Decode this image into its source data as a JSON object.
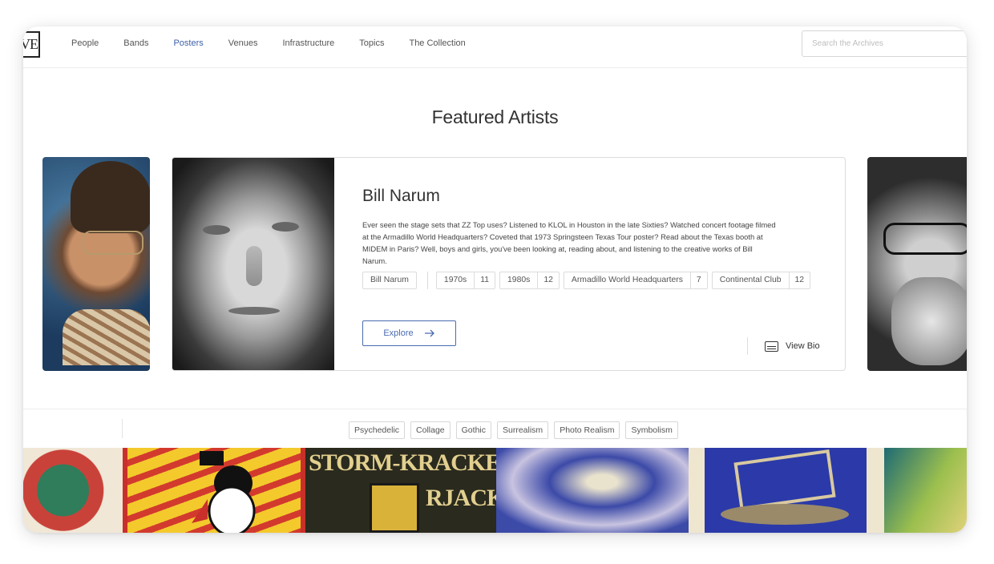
{
  "nav": {
    "logo_text": "VES",
    "items": [
      {
        "label": "People",
        "active": false
      },
      {
        "label": "Bands",
        "active": false
      },
      {
        "label": "Posters",
        "active": true
      },
      {
        "label": "Venues",
        "active": false
      },
      {
        "label": "Infrastructure",
        "active": false
      },
      {
        "label": "Topics",
        "active": false
      },
      {
        "label": "The Collection",
        "active": false
      }
    ],
    "search_placeholder": "Search the Archives",
    "accent_color": "#3d5fa6"
  },
  "featured": {
    "title": "Featured Artists",
    "artist": {
      "name": "Bill Narum",
      "description": "Ever seen the stage sets that ZZ Top uses? Listened to KLOL in Houston in the late Sixties? Watched concert footage filmed at the Armadillo World Headquarters? Coveted that 1973 Springsteen Texas Tour poster? Read about the Texas booth at MIDEM in Paris? Well, boys and girls, you've been looking at, reading about, and listening to the creative works of Bill Narum.",
      "name_tag": "Bill Narum",
      "tags": [
        {
          "label": "1970s",
          "count": "11"
        },
        {
          "label": "1980s",
          "count": "12"
        },
        {
          "label": "Armadillo World Headquarters",
          "count": "7"
        },
        {
          "label": "Continental Club",
          "count": "12"
        }
      ],
      "explore_label": "Explore",
      "bio_label": "View Bio"
    }
  },
  "styles": [
    "Psychedelic",
    "Collage",
    "Gothic",
    "Surrealism",
    "Photo Realism",
    "Symbolism"
  ],
  "posters": [
    {
      "name": "poster-psychedelic-green",
      "text": "",
      "colors": [
        "#2f7d5a",
        "#c9423a"
      ]
    },
    {
      "name": "poster-penguin",
      "text": "",
      "colors": [
        "#f3c92c",
        "#d33a2e"
      ]
    },
    {
      "name": "poster-storm-kracker",
      "text": "STORM-KRACKE- RJACK",
      "colors": [
        "#2a2a1e",
        "#e2cf8f"
      ]
    },
    {
      "name": "poster-blue-face",
      "text": "",
      "colors": [
        "#3c4aa8",
        "#e9e2cd"
      ]
    },
    {
      "name": "poster-starry",
      "text": "",
      "colors": [
        "#2b3aa8",
        "#c8b98d"
      ]
    },
    {
      "name": "poster-green-partial",
      "text": "",
      "colors": [
        "#1e6a74",
        "#9bbf4e"
      ]
    }
  ]
}
